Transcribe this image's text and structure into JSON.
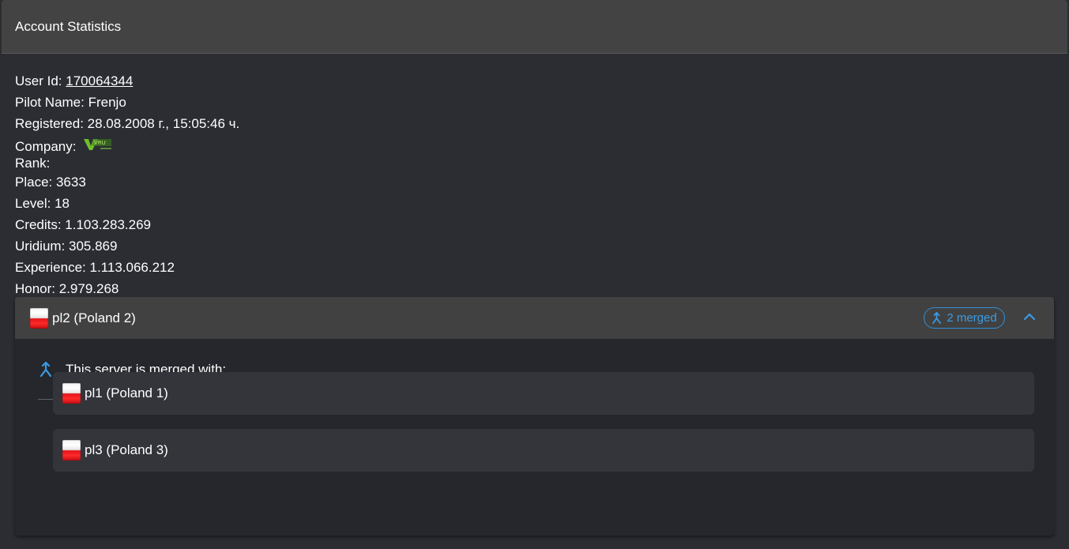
{
  "card": {
    "title": "Account Statistics"
  },
  "stats": {
    "user_id_label": "User Id: ",
    "user_id": "170064344",
    "pilot_name": "Pilot Name: Frenjo",
    "registered": "Registered: 28.08.2008 г., 15:05:46 ч.",
    "company_label": "Company:",
    "company_logo_text": "VRU",
    "rank_label": "Rank:",
    "place": "Place: 3633",
    "level": "Level: 18",
    "credits": "Credits: 1.103.283.269",
    "uridium": "Uridium: 305.869",
    "experience": "Experience: 1.113.066.212",
    "honor": "Honor: 2.979.268"
  },
  "server": {
    "flag_icon": "poland-flag-icon",
    "name": "pl2 (Poland 2)",
    "merged_badge": "2 merged",
    "merge_icon": "merge-icon",
    "collapse_icon": "chevron-up-icon",
    "merged_heading": "This server is merged with:",
    "merged_servers": [
      {
        "name": "pl1 (Poland 1)",
        "flag_icon": "poland-flag-icon"
      },
      {
        "name": "pl3 (Poland 3)",
        "flag_icon": "poland-flag-icon"
      }
    ]
  },
  "colors": {
    "accent": "#3a9ce6",
    "header_bg": "#434343",
    "page_bg": "#2b2d33"
  }
}
